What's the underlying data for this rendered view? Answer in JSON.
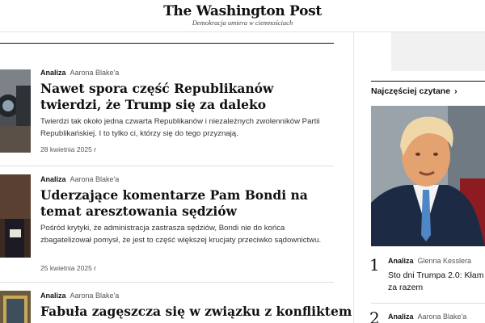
{
  "masthead": {
    "logo": "The Washington Post",
    "tagline": "Demokracja umiera w ciemnościach"
  },
  "stories": [
    {
      "kicker": "Analiza",
      "author": "Aarona Blake'a",
      "title": "Nawet spora część Republikanów twierdzi, że Trump się za daleko",
      "blurb": "Twierdzi tak około jedna czwarta Republikanów i niezależnych zwolenników Partii Republikańskiej. I to tylko ci, którzy się do tego przyznają.",
      "date": "28 kwietnia 2025 r"
    },
    {
      "kicker": "Analiza",
      "author": "Aarona Blake'a",
      "title": "Uderzające komentarze Pam Bondi na temat aresztowania sędziów",
      "blurb": "Pośród krytyki, że administracja zastrasza sędziów, Bondi nie do końca zbagatelizował pomysł, że jest to część większej krucjaty przeciwko sądownictwu.",
      "date": "25 kwietnia 2025 r"
    },
    {
      "kicker": "Analiza",
      "author": "Aarona Blake'a",
      "title": "Fabuła zagęszcza się w związku z konfliktem"
    }
  ],
  "sidebar": {
    "popular_heading": "Najczęściej czytane",
    "popular_chevron": "›",
    "items": [
      {
        "rank": "1",
        "kicker": "Analiza",
        "author": "Glenna Kesslera",
        "title": "Sto dni Trumpa 2.0: Kłam za razem"
      },
      {
        "rank": "2",
        "kicker": "Analiza",
        "author": "Aarona Blake'a"
      }
    ]
  },
  "colors": {
    "text": "#111111",
    "meta": "#555555",
    "divider": "#e0e0e0",
    "ad_placeholder": "#f1f1f1"
  }
}
